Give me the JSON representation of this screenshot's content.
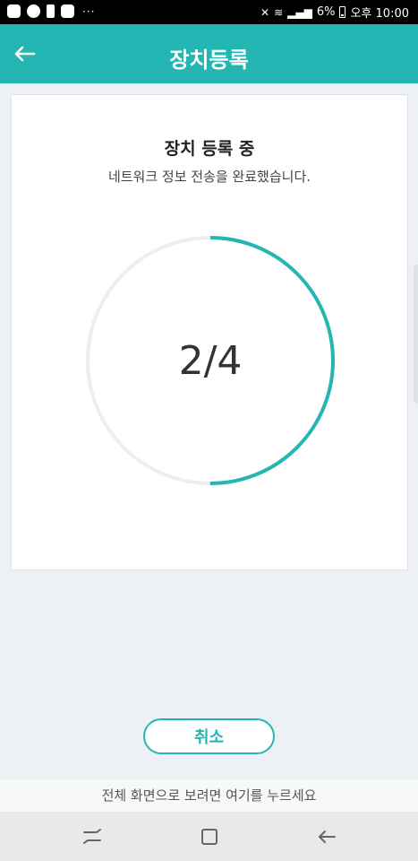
{
  "status_bar": {
    "battery": "6%",
    "time": "오후 10:00",
    "notif_icons": [
      "phone-icon",
      "chat-icon",
      "lock-icon",
      "message-icon"
    ],
    "overflow": "···"
  },
  "header": {
    "title": "장치등록",
    "back_icon": "arrow-left-icon",
    "color": "#24b6b2"
  },
  "registration": {
    "title": "장치 등록 중",
    "subtitle": "네트워크 정보 전송을 완료했습니다.",
    "progress_label": "2/4",
    "current_step": 2,
    "total_steps": 4,
    "progress_color": "#24b6b2",
    "track_color": "#eeeeee"
  },
  "actions": {
    "cancel_label": "취소"
  },
  "fullscreen_hint": "전체 화면으로 보려면 여기를 누르세요",
  "nav_bar": {
    "icons": [
      "recent-apps-icon",
      "home-icon",
      "back-icon"
    ]
  }
}
